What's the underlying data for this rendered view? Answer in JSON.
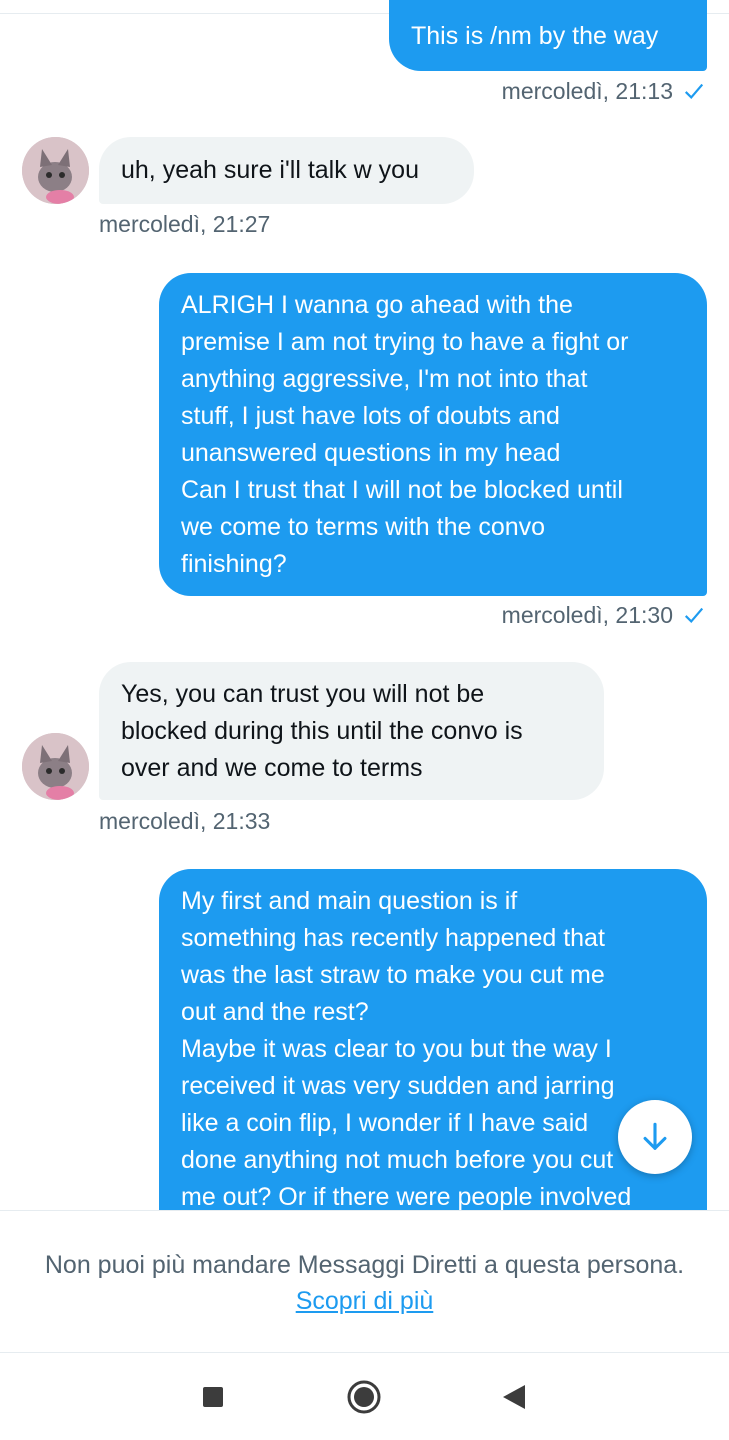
{
  "messages": [
    {
      "dir": "out",
      "text": "This is /nm by the way",
      "time": "mercoledì, 21:13"
    },
    {
      "dir": "in",
      "text": "uh, yeah sure i'll talk w you",
      "time": "mercoledì, 21:27"
    },
    {
      "dir": "out",
      "text": "ALRIGH I wanna go ahead with the\npremise I am not trying to have a fight or\nanything aggressive, I'm not into that\nstuff, I just have lots of doubts and\nunanswered questions in my head\nCan I trust that I will not be blocked until\nwe come to terms with the convo\nfinishing?",
      "time": "mercoledì, 21:30"
    },
    {
      "dir": "in",
      "text": "Yes, you can trust you will not be\nblocked during this until the convo is\nover and we come to terms",
      "time": "mercoledì, 21:33"
    },
    {
      "dir": "out",
      "text": "My first and main question is if\nsomething has recently happened that\nwas the last straw to make you cut me\nout and the rest?\nMaybe it was clear to you but the way I\nreceived it was very sudden and jarring\nlike a coin flip, I wonder if I have said\ndone anything not much before you cut\nme out? Or if there were people involved"
    }
  ],
  "footer": {
    "notice": "Non puoi più mandare Messaggi Diretti a questa persona.",
    "learn_more": "Scopri di più"
  },
  "colors": {
    "accent": "#1d9bf0",
    "incoming_bubble": "#eff3f4",
    "meta_text": "#536471"
  },
  "icons": {
    "read_receipt": "checkmark-icon",
    "scroll_down": "arrow-down-icon",
    "nav_recents": "square-icon",
    "nav_home": "circle-icon",
    "nav_back": "triangle-back-icon"
  }
}
